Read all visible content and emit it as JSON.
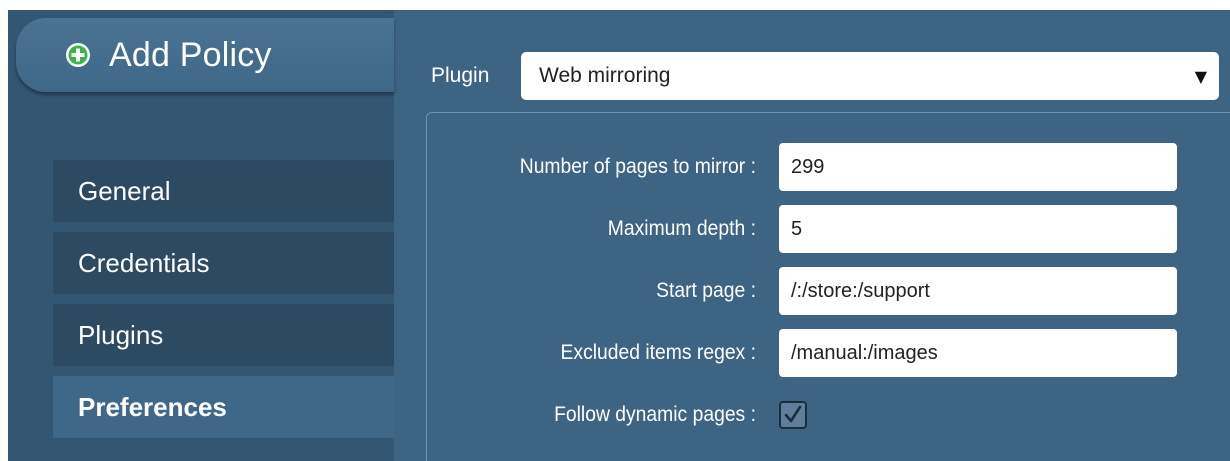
{
  "sidebar": {
    "header": {
      "title": "Add Policy",
      "icon": "plus-circle-icon"
    },
    "items": [
      {
        "label": "General",
        "active": false
      },
      {
        "label": "Credentials",
        "active": false
      },
      {
        "label": "Plugins",
        "active": false
      },
      {
        "label": "Preferences",
        "active": true
      }
    ]
  },
  "plugin": {
    "label": "Plugin",
    "selected": "Web mirroring"
  },
  "form": {
    "pages_label": "Number of pages to mirror :",
    "pages_value": "299",
    "depth_label": "Maximum depth :",
    "depth_value": "5",
    "start_label": "Start page :",
    "start_value": "/:/store:/support",
    "excluded_label": "Excluded items regex :",
    "excluded_value": "/manual:/images",
    "dynamic_label": "Follow dynamic pages :",
    "dynamic_checked": true
  },
  "colors": {
    "background": "#3d6482",
    "sidebar": "#335673",
    "nav_item": "#2c4b63",
    "nav_active": "#3f6888",
    "add_icon": "#3cb44a"
  }
}
